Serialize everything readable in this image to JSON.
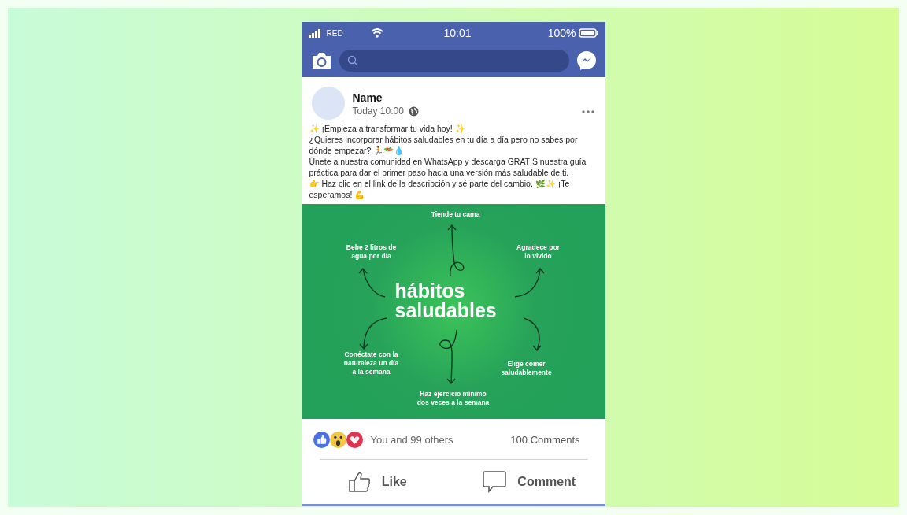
{
  "status_bar": {
    "carrier": "RED",
    "time": "10:01",
    "battery": "100%"
  },
  "post": {
    "author": "Name",
    "time": "Today 10:00",
    "caption": [
      "✨ ¡Empieza a transformar tu vida hoy! ✨",
      "¿Quieres incorporar hábitos saludables en tu día a día pero no sabes por dónde empezar? 🏃🥗💧",
      "Únete a nuestra comunidad en WhatsApp y descarga GRATIS nuestra guía práctica para dar el primer paso hacia una versión más saludable de ti.",
      "👉 Haz clic en el link de la descripción y sé parte del cambio. 🌿✨ ¡Te esperamos! 💪"
    ],
    "image": {
      "title_lines": [
        "hábitos",
        "saludables"
      ],
      "labels": [
        {
          "lines": [
            "Tiende tu cama"
          ]
        },
        {
          "lines": [
            "Bebe 2 litros de",
            "agua por día"
          ]
        },
        {
          "lines": [
            "Agradece por",
            "lo vivido"
          ]
        },
        {
          "lines": [
            "Conéctate con la",
            "naturaleza un día",
            "a la semana"
          ]
        },
        {
          "lines": [
            "Elige comer",
            "saludablemente"
          ]
        },
        {
          "lines": [
            "Haz ejercicio mínimo",
            "dos veces a la semana"
          ]
        }
      ]
    },
    "reactions": "You and 99 others",
    "comments": "100 Comments",
    "actions": [
      {
        "kind": "like",
        "label": "Like"
      },
      {
        "kind": "comment",
        "label": "Comment"
      }
    ]
  }
}
